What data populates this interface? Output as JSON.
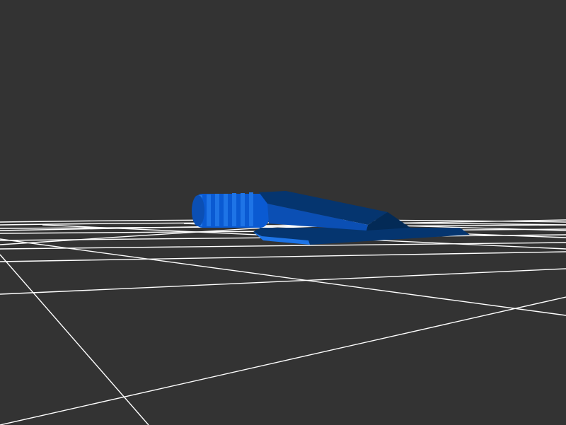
{
  "viewer": {
    "background_color": "#333333",
    "grid_color": "#ffffff",
    "model_colors": {
      "base": "#0a5ad2",
      "light": "#1e74e6",
      "mid": "#0b4fb4",
      "dark": "#05356f",
      "darker": "#032a56"
    },
    "icons": [
      "grid-floor",
      "3d-model"
    ]
  }
}
